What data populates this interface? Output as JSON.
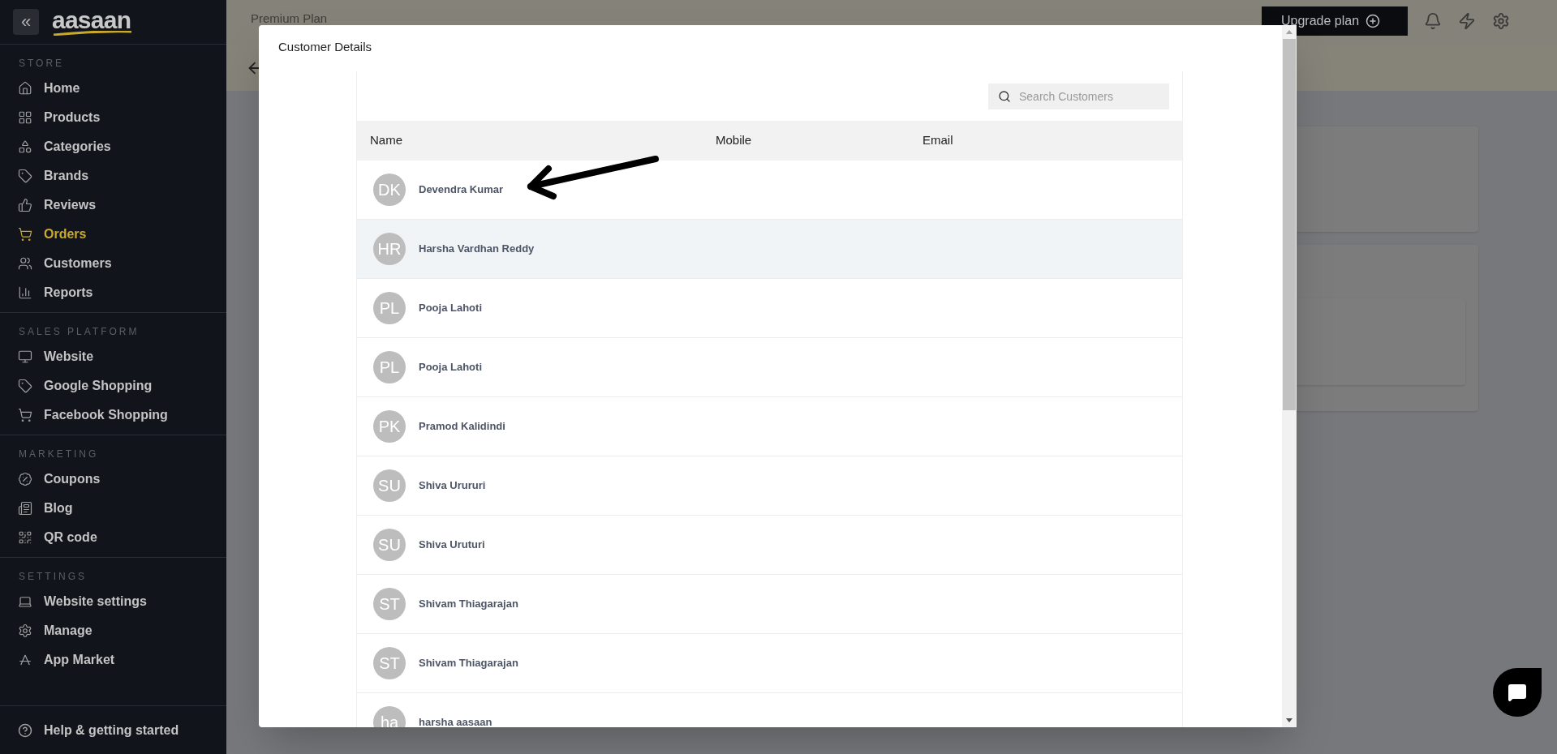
{
  "sidebar": {
    "logo": "aasaan",
    "collapse_icon": "«",
    "sections": [
      {
        "title": "STORE",
        "items": [
          {
            "label": "Home",
            "selected": false
          },
          {
            "label": "Products",
            "selected": false
          },
          {
            "label": "Categories",
            "selected": false
          },
          {
            "label": "Brands",
            "selected": false
          },
          {
            "label": "Reviews",
            "selected": false
          },
          {
            "label": "Orders",
            "selected": true
          },
          {
            "label": "Customers",
            "selected": false
          },
          {
            "label": "Reports",
            "selected": false
          }
        ]
      },
      {
        "title": "SALES PLATFORM",
        "items": [
          {
            "label": "Website",
            "selected": false
          },
          {
            "label": "Google Shopping",
            "selected": false
          },
          {
            "label": "Facebook Shopping",
            "selected": false
          }
        ]
      },
      {
        "title": "MARKETING",
        "items": [
          {
            "label": "Coupons",
            "selected": false
          },
          {
            "label": "Blog",
            "selected": false
          },
          {
            "label": "QR code",
            "selected": false
          }
        ]
      },
      {
        "title": "SETTINGS",
        "items": [
          {
            "label": "Website settings",
            "selected": false
          },
          {
            "label": "Manage",
            "selected": false
          },
          {
            "label": "App Market",
            "selected": false
          }
        ]
      }
    ],
    "help": "Help & getting started"
  },
  "topbar": {
    "plan": "Premium Plan",
    "upgrade_button": "Upgrade plan"
  },
  "modal": {
    "title": "Customer Details",
    "search": {
      "placeholder": "Search Customers"
    },
    "columns": [
      "Name",
      "Mobile",
      "Email"
    ],
    "rows": [
      {
        "initials": "DK",
        "name": "Devendra Kumar",
        "selected": false
      },
      {
        "initials": "HR",
        "name": "Harsha Vardhan Reddy",
        "selected": true
      },
      {
        "initials": "PL",
        "name": "Pooja Lahoti",
        "selected": false
      },
      {
        "initials": "PL",
        "name": "Pooja Lahoti",
        "selected": false
      },
      {
        "initials": "PK",
        "name": "Pramod Kalidindi",
        "selected": false
      },
      {
        "initials": "SU",
        "name": "Shiva Urururi",
        "selected": false
      },
      {
        "initials": "SU",
        "name": "Shiva Uruturi",
        "selected": false
      },
      {
        "initials": "ST",
        "name": "Shivam Thiagarajan",
        "selected": false
      },
      {
        "initials": "ST",
        "name": "Shivam Thiagarajan",
        "selected": false
      },
      {
        "initials": "ha",
        "name": "harsha aasaan",
        "selected": false
      }
    ]
  }
}
